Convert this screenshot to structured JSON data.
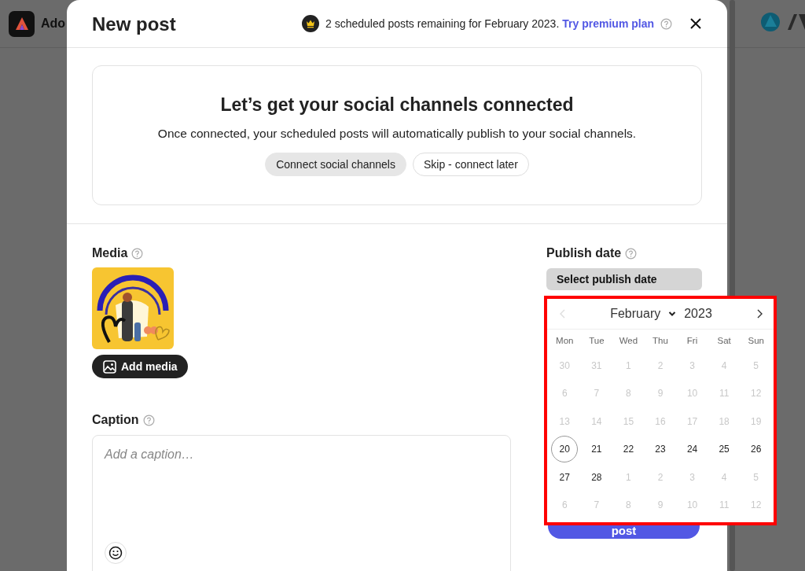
{
  "app_header": {
    "title": "Ado"
  },
  "dialog": {
    "title": "New post",
    "quota_notice": "2 scheduled posts remaining for February 2023.",
    "upgrade_link": "Try premium plan"
  },
  "connect_card": {
    "title": "Let’s get your social channels connected",
    "subtitle": "Once connected, your scheduled posts will automatically publish to your social channels.",
    "buttons": [
      {
        "label": "Connect social channels",
        "kind": "filled"
      },
      {
        "label": "Skip - connect later",
        "kind": "outline"
      }
    ]
  },
  "media": {
    "label": "Media",
    "add_button": "Add media"
  },
  "caption": {
    "label": "Caption",
    "placeholder": "Add a caption…"
  },
  "publish_date": {
    "label": "Publish date",
    "button": "Select publish date"
  },
  "calendar": {
    "month": "February",
    "year": "2023",
    "prev_disabled": true,
    "weekdays": [
      "Mon",
      "Tue",
      "Wed",
      "Thu",
      "Fri",
      "Sat",
      "Sun"
    ],
    "weeks": [
      [
        {
          "day": "30",
          "muted": true,
          "selected": false
        },
        {
          "day": "31",
          "muted": true,
          "selected": false
        },
        {
          "day": "1",
          "muted": true,
          "selected": false
        },
        {
          "day": "2",
          "muted": true,
          "selected": false
        },
        {
          "day": "3",
          "muted": true,
          "selected": false
        },
        {
          "day": "4",
          "muted": true,
          "selected": false
        },
        {
          "day": "5",
          "muted": true,
          "selected": false
        }
      ],
      [
        {
          "day": "6",
          "muted": true,
          "selected": false
        },
        {
          "day": "7",
          "muted": true,
          "selected": false
        },
        {
          "day": "8",
          "muted": true,
          "selected": false
        },
        {
          "day": "9",
          "muted": true,
          "selected": false
        },
        {
          "day": "10",
          "muted": true,
          "selected": false
        },
        {
          "day": "11",
          "muted": true,
          "selected": false
        },
        {
          "day": "12",
          "muted": true,
          "selected": false
        }
      ],
      [
        {
          "day": "13",
          "muted": true,
          "selected": false
        },
        {
          "day": "14",
          "muted": true,
          "selected": false
        },
        {
          "day": "15",
          "muted": true,
          "selected": false
        },
        {
          "day": "16",
          "muted": true,
          "selected": false
        },
        {
          "day": "17",
          "muted": true,
          "selected": false
        },
        {
          "day": "18",
          "muted": true,
          "selected": false
        },
        {
          "day": "19",
          "muted": true,
          "selected": false
        }
      ],
      [
        {
          "day": "20",
          "muted": false,
          "selected": true
        },
        {
          "day": "21",
          "muted": false,
          "selected": false
        },
        {
          "day": "22",
          "muted": false,
          "selected": false
        },
        {
          "day": "23",
          "muted": false,
          "selected": false
        },
        {
          "day": "24",
          "muted": false,
          "selected": false
        },
        {
          "day": "25",
          "muted": false,
          "selected": false
        },
        {
          "day": "26",
          "muted": false,
          "selected": false
        }
      ],
      [
        {
          "day": "27",
          "muted": false,
          "selected": false
        },
        {
          "day": "28",
          "muted": false,
          "selected": false
        },
        {
          "day": "1",
          "muted": true,
          "selected": false
        },
        {
          "day": "2",
          "muted": true,
          "selected": false
        },
        {
          "day": "3",
          "muted": true,
          "selected": false
        },
        {
          "day": "4",
          "muted": true,
          "selected": false
        },
        {
          "day": "5",
          "muted": true,
          "selected": false
        }
      ],
      [
        {
          "day": "6",
          "muted": true,
          "selected": false
        },
        {
          "day": "7",
          "muted": true,
          "selected": false
        },
        {
          "day": "8",
          "muted": true,
          "selected": false
        },
        {
          "day": "9",
          "muted": true,
          "selected": false
        },
        {
          "day": "10",
          "muted": true,
          "selected": false
        },
        {
          "day": "11",
          "muted": true,
          "selected": false
        },
        {
          "day": "12",
          "muted": true,
          "selected": false
        }
      ]
    ]
  },
  "submit_button": {
    "label": "post"
  }
}
